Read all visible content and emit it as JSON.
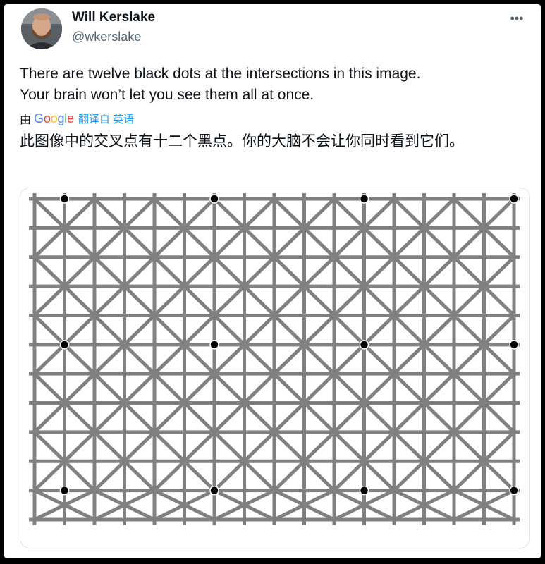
{
  "tweet": {
    "author": {
      "display_name": "Will Kerslake",
      "handle": "@wkerslake",
      "avatar_icon": "user-avatar-photo"
    },
    "more_icon": "more-options-icon",
    "text_lines": [
      "There are twelve black dots at the intersections in this image.",
      "Your brain won’t let you see them all at once."
    ],
    "translation": {
      "by_label": "由",
      "provider": "Google",
      "link_label": "翻译自 英语",
      "text": "此图像中的交叉点有十二个黑点。你的大脑不会让你同时看到它们。"
    },
    "media": {
      "line_color": "#808080",
      "dot_color": "#000000",
      "dot_count": 12
    }
  }
}
